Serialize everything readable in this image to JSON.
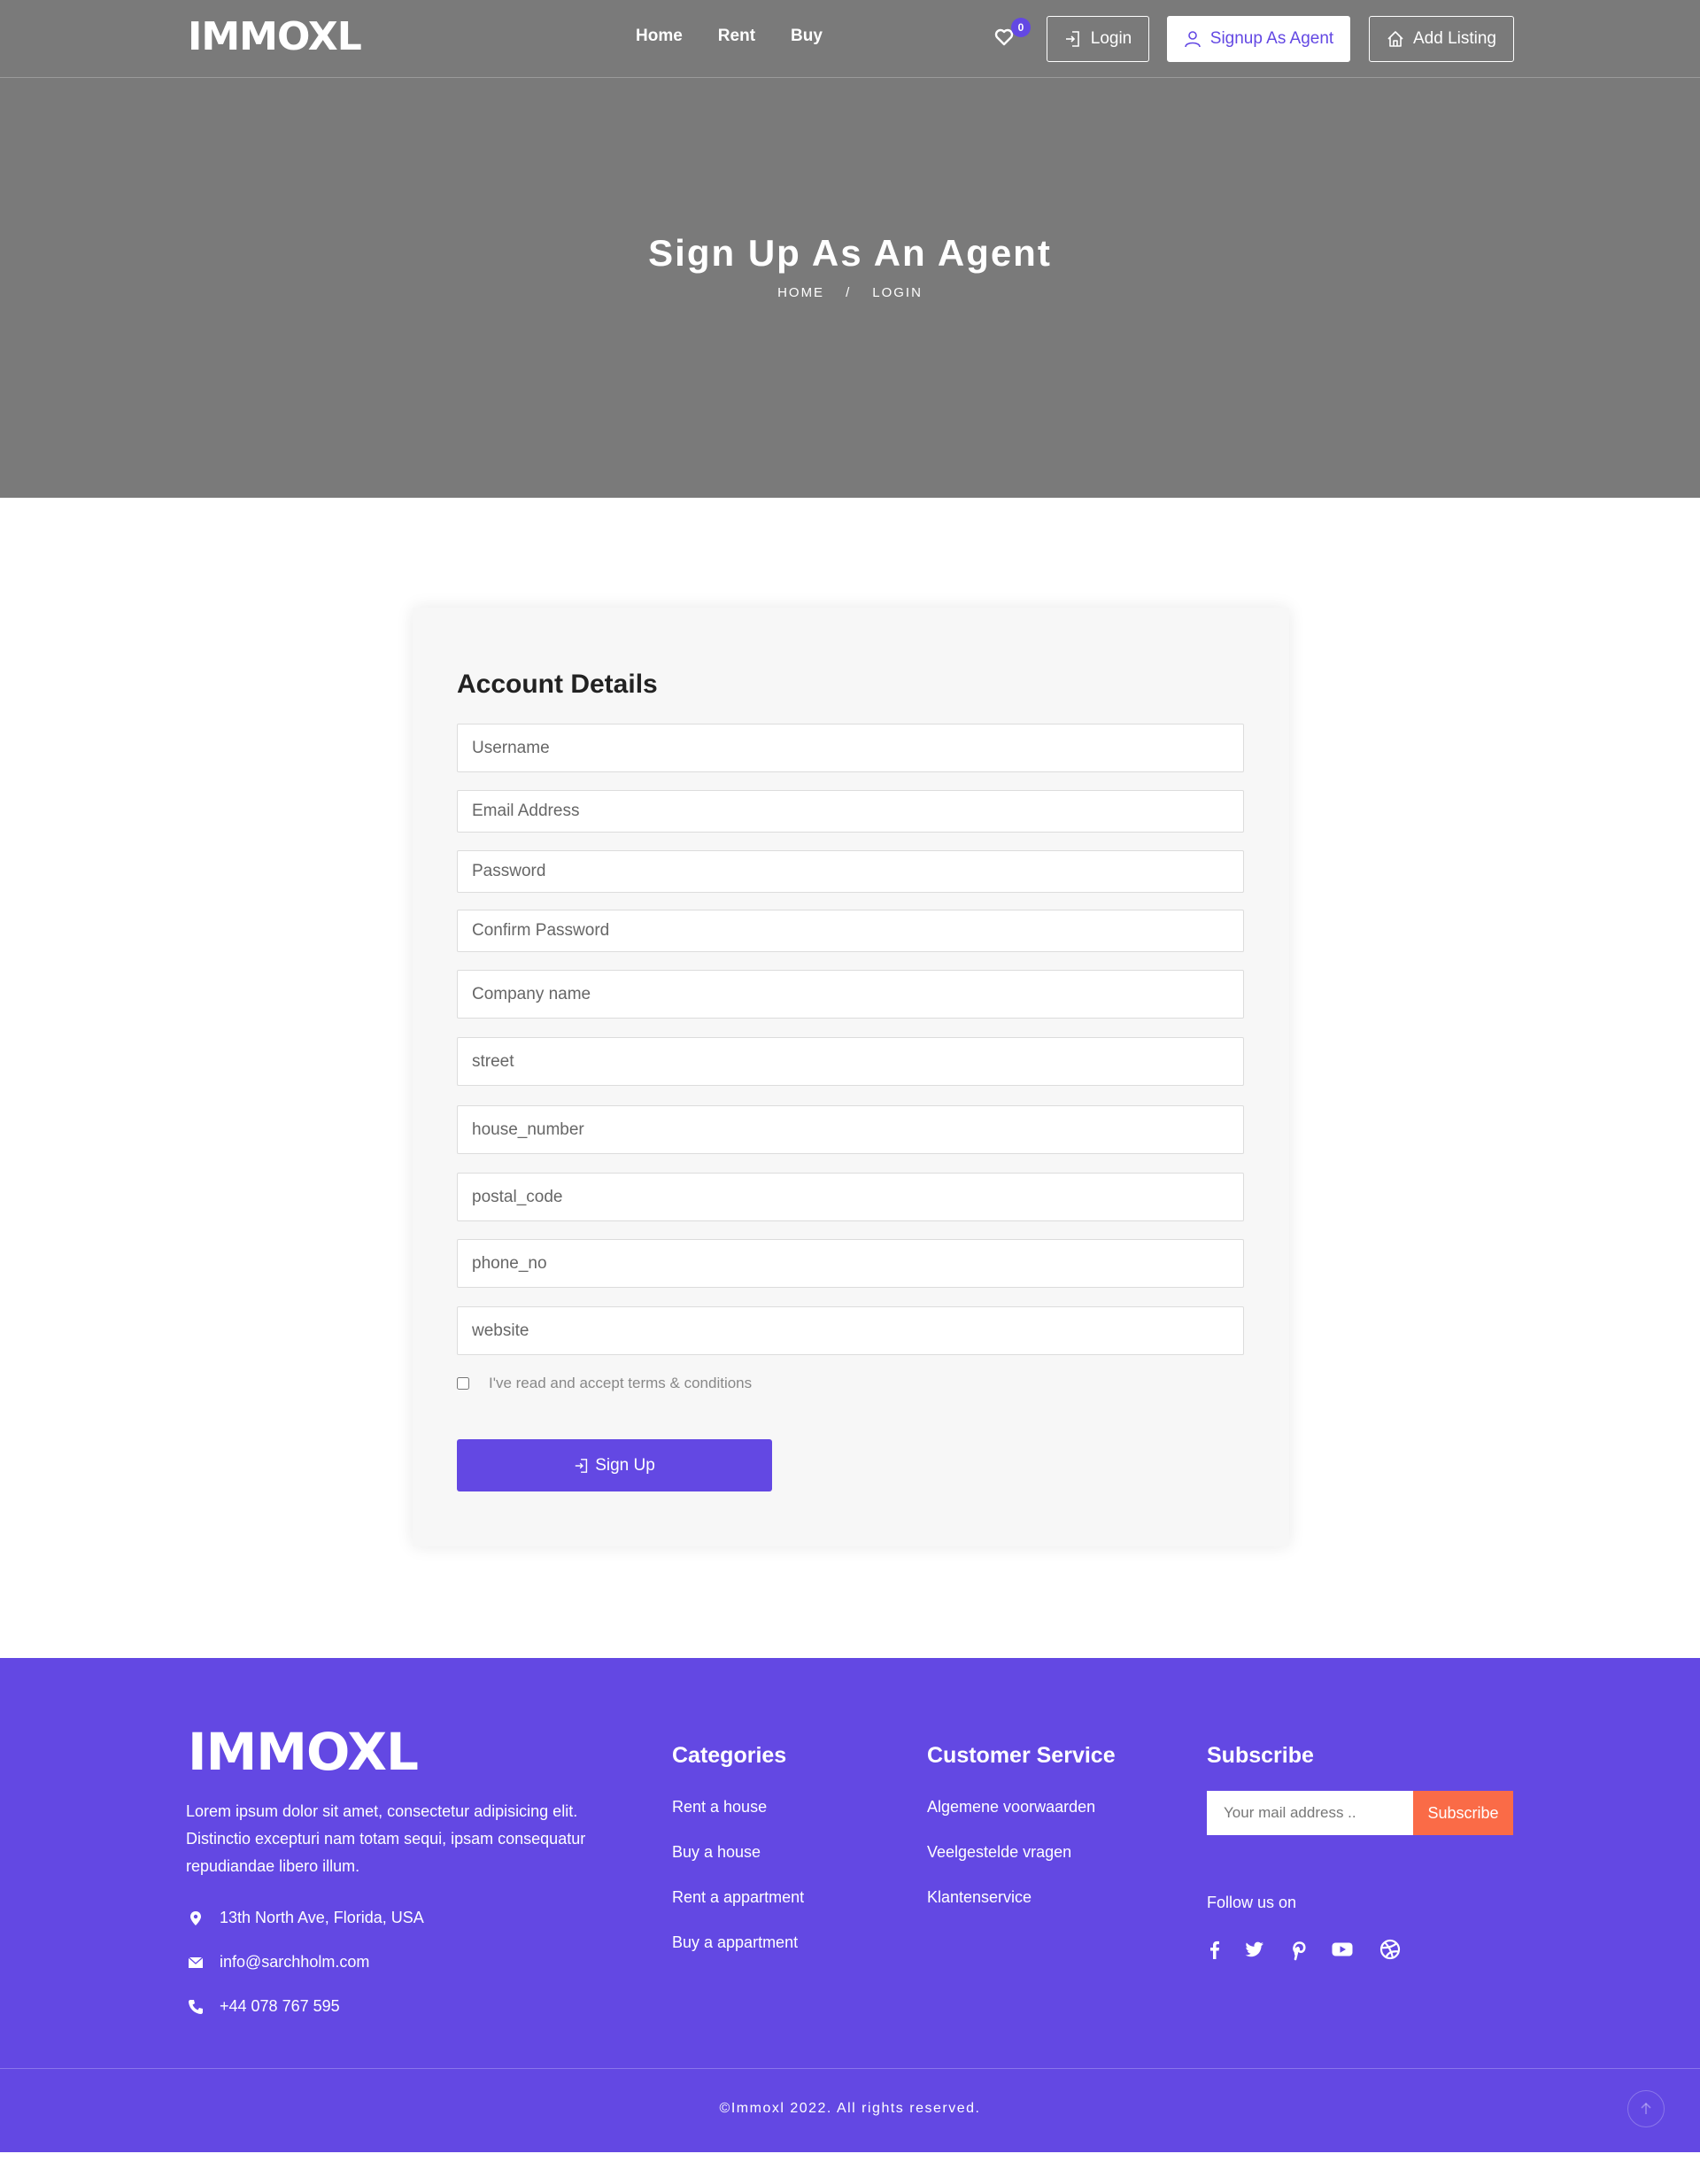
{
  "header": {
    "logo": "IMMOXL",
    "nav": [
      "Home",
      "Rent",
      "Buy"
    ],
    "wishlist_count": "0",
    "login_label": "Login",
    "signup_agent_label": "Signup As Agent",
    "add_listing_label": "Add Listing"
  },
  "hero": {
    "title": "Sign Up As An Agent",
    "breadcrumb": [
      "HOME",
      "/",
      "LOGIN"
    ]
  },
  "form": {
    "title": "Account Details",
    "fields": [
      {
        "placeholder": "Username",
        "value": ""
      },
      {
        "placeholder": "Email Address",
        "value": ""
      },
      {
        "placeholder": "Password",
        "value": ""
      },
      {
        "placeholder": "Confirm Password",
        "value": ""
      },
      {
        "placeholder": "Company name",
        "value": ""
      },
      {
        "placeholder": "street",
        "value": ""
      },
      {
        "placeholder": "house_number",
        "value": ""
      },
      {
        "placeholder": "postal_code",
        "value": ""
      },
      {
        "placeholder": "phone_no",
        "value": ""
      },
      {
        "placeholder": "website",
        "value": ""
      }
    ],
    "terms_label": "I've read and accept terms & conditions",
    "submit_label": "Sign Up"
  },
  "footer": {
    "logo": "IMMOXL",
    "about": "Lorem ipsum dolor sit amet, consectetur adipisicing elit. Distinctio excepturi nam totam sequi, ipsam consequatur repudiandae libero illum.",
    "address": "13th North Ave, Florida, USA",
    "email": "info@sarchholm.com",
    "phone": "+44 078 767 595",
    "categories": {
      "title": "Categories",
      "links": [
        "Rent a house",
        "Buy a house",
        "Rent a appartment",
        "Buy a appartment"
      ]
    },
    "customer_service": {
      "title": "Customer Service",
      "links": [
        "Algemene voorwaarden",
        "Veelgestelde vragen",
        "Klantenservice"
      ]
    },
    "subscribe": {
      "title": "Subscribe",
      "placeholder": "Your mail address ..",
      "button": "Subscribe",
      "follow_label": "Follow us on",
      "social_icons": [
        "facebook-icon",
        "twitter-icon",
        "pinterest-icon",
        "youtube-icon",
        "dribbble-icon"
      ]
    },
    "copyright": "©Immoxl 2022. All rights reserved."
  },
  "colors": {
    "accent": "#6348e3",
    "hero_overlay": "#7a7a7a",
    "subscribe_button": "#fa6b47"
  }
}
